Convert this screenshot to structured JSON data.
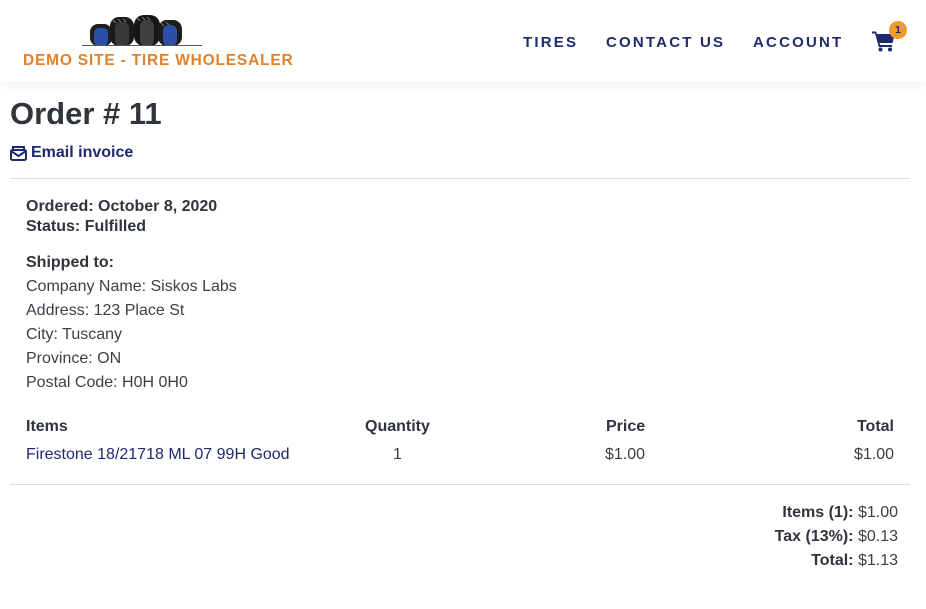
{
  "header": {
    "logo_text": "DEMO SITE - TIRE WHOLESALER",
    "nav": {
      "tires": "TIRES",
      "contact": "CONTACT US",
      "account": "ACCOUNT"
    },
    "cart_count": "1",
    "icons": {
      "cart": "shopping-cart-icon",
      "logo": "tires-logo"
    },
    "colors": {
      "nav": "#1e2a6b",
      "logo_text": "#e0822a",
      "badge": "#f39a2c"
    }
  },
  "order": {
    "title": "Order # 11",
    "email_invoice": "Email invoice",
    "ordered_label": "Ordered:",
    "ordered_date": "October 8, 2020",
    "status_label": "Status:",
    "status_value": "Fulfilled",
    "shipped_to_label": "Shipped to:",
    "company": "Company Name: Siskos Labs",
    "address": "Address: 123 Place St",
    "city": "City: Tuscany",
    "province": "Province: ON",
    "postal": "Postal Code: H0H 0H0"
  },
  "items_table": {
    "columns": [
      "Items",
      "Quantity",
      "Price",
      "Total"
    ],
    "rows": [
      {
        "item": "Firestone 18/21718 ML 07 99H Good",
        "quantity": "1",
        "price": "$1.00",
        "total": "$1.00"
      }
    ]
  },
  "summary": {
    "items_label": "Items (1):",
    "items_value": "$1.00",
    "tax_label": "Tax (13%):",
    "tax_value": "$0.13",
    "total_label": "Total:",
    "total_value": "$1.13"
  }
}
